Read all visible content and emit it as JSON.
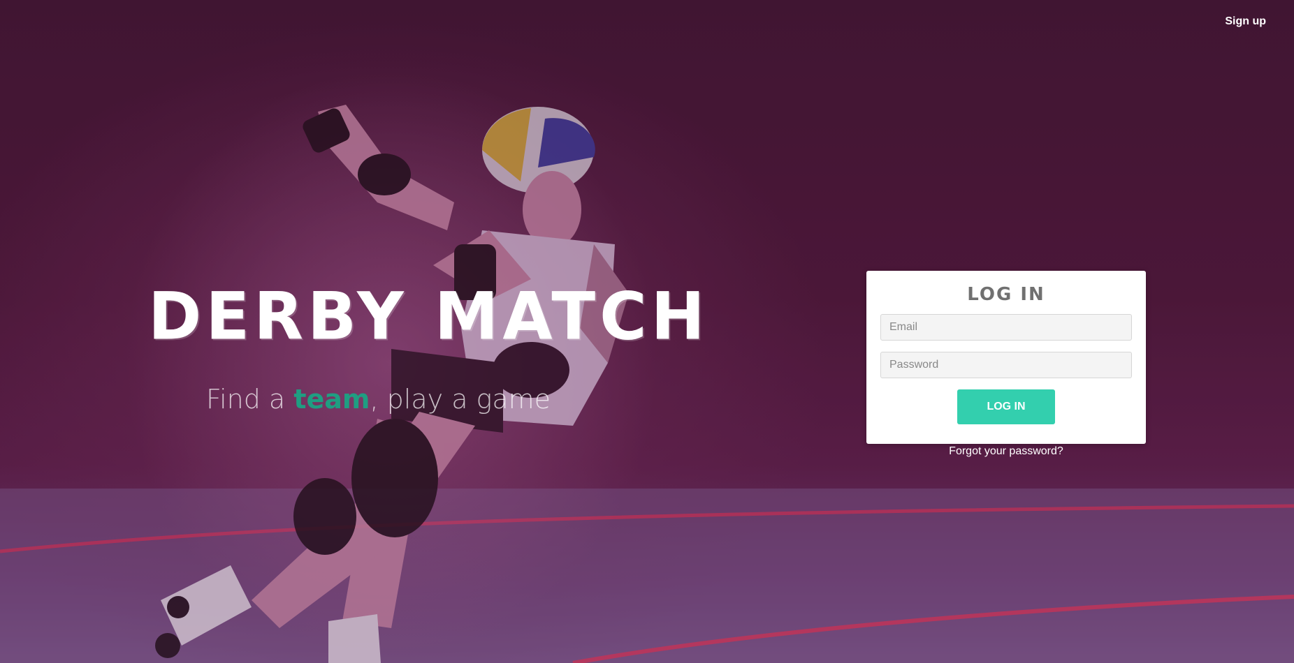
{
  "header": {
    "signup_label": "Sign up"
  },
  "hero": {
    "title": "DERBY MATCH",
    "subtitle_before": "Find a ",
    "subtitle_highlight": "team",
    "subtitle_after": ", play a game"
  },
  "login": {
    "heading": "LOG IN",
    "email_placeholder": "Email",
    "password_placeholder": "Password",
    "button_label": "LOG IN",
    "forgot_label": "Forgot your password?"
  },
  "colors": {
    "accent": "#33cfae",
    "highlight_text": "#1f9e82",
    "background": "#4b1838"
  }
}
